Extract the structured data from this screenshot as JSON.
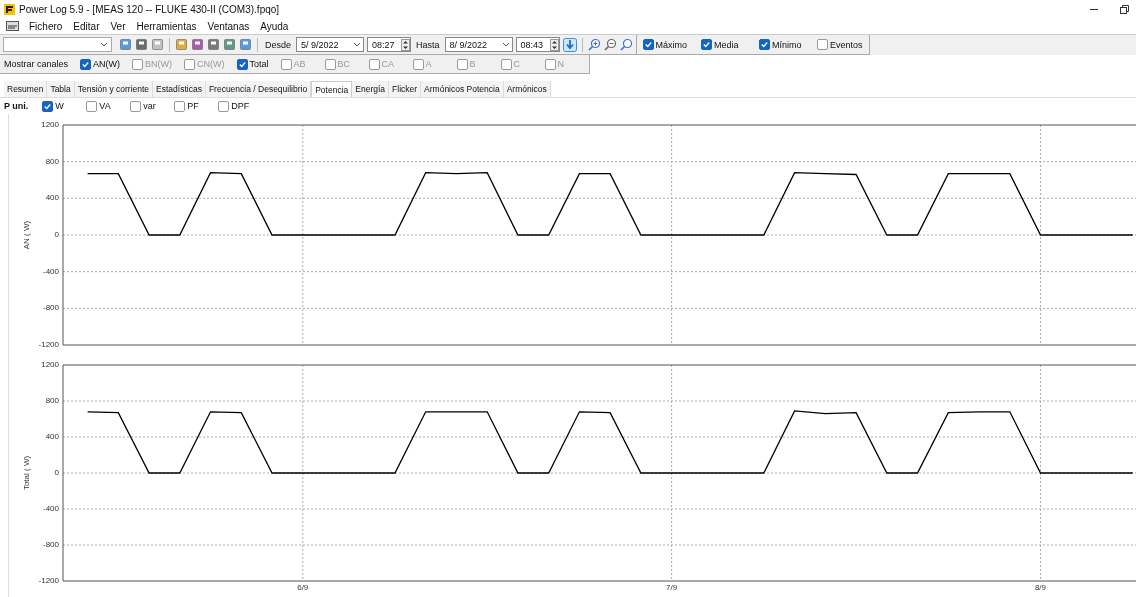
{
  "window": {
    "title": "Power Log 5.9 - [MEAS 120 -- FLUKE 430-II (COM3).fpqo]"
  },
  "menu": [
    "Fichero",
    "Editar",
    "Ver",
    "Herramientas",
    "Ventanas",
    "Ayuda"
  ],
  "range": {
    "from_label": "Desde",
    "from_date": "5/ 9/2022",
    "from_time": "08:27",
    "to_label": "Hasta",
    "to_date": "8/ 9/2022",
    "to_time": "08:43"
  },
  "display_options": [
    {
      "label": "Máximo",
      "checked": true
    },
    {
      "label": "Media",
      "checked": true
    },
    {
      "label": "Mínimo",
      "checked": true
    },
    {
      "label": "Eventos",
      "checked": false
    }
  ],
  "channels": {
    "label": "Mostrar canales",
    "items": [
      {
        "label": "AN(W)",
        "checked": true,
        "disabled": false
      },
      {
        "label": "BN(W)",
        "checked": false,
        "disabled": true
      },
      {
        "label": "CN(W)",
        "checked": false,
        "disabled": true
      },
      {
        "label": "Total",
        "checked": true,
        "disabled": false
      },
      {
        "label": "AB",
        "checked": false,
        "disabled": true
      },
      {
        "label": "BC",
        "checked": false,
        "disabled": true
      },
      {
        "label": "CA",
        "checked": false,
        "disabled": true
      },
      {
        "label": "A",
        "checked": false,
        "disabled": true
      },
      {
        "label": "B",
        "checked": false,
        "disabled": true
      },
      {
        "label": "C",
        "checked": false,
        "disabled": true
      },
      {
        "label": "N",
        "checked": false,
        "disabled": true
      }
    ]
  },
  "tabs": [
    {
      "label": "Resumen",
      "selected": false
    },
    {
      "label": "Tabla",
      "selected": false
    },
    {
      "label": "Tensión y corriente",
      "selected": false
    },
    {
      "label": "Estadísticas",
      "selected": false
    },
    {
      "label": "Frecuencia / Desequilibrio",
      "selected": false
    },
    {
      "label": "Potencia",
      "selected": true
    },
    {
      "label": "Energía",
      "selected": false
    },
    {
      "label": "Flicker",
      "selected": false
    },
    {
      "label": "Armónicos Potencia",
      "selected": false
    },
    {
      "label": "Armónicos",
      "selected": false
    }
  ],
  "units": {
    "label": "P uni.",
    "items": [
      {
        "label": "W",
        "checked": true
      },
      {
        "label": "VA",
        "checked": false
      },
      {
        "label": "var",
        "checked": false
      },
      {
        "label": "PF",
        "checked": false
      },
      {
        "label": "DPF",
        "checked": false
      }
    ]
  },
  "charts": [
    {
      "chart_data": {
        "type": "line",
        "grid": true,
        "ylabel": "AN ( W)",
        "ylim": [
          -1200,
          1200
        ],
        "yticks": [
          1200,
          800,
          400,
          0,
          -400,
          -800,
          -1200
        ],
        "categories": [
          null,
          null,
          null,
          null,
          null,
          null,
          null,
          null,
          null,
          null,
          null,
          null,
          null,
          null,
          null,
          null,
          null,
          null,
          null,
          null,
          null,
          null,
          null,
          null,
          null,
          null,
          null,
          null,
          null,
          null,
          null,
          null,
          null,
          null,
          null
        ],
        "series": [
          {
            "color": "#000000",
            "values": [
              670,
              670,
              0,
              0,
              680,
              670,
              0,
              0,
              0,
              0,
              0,
              680,
              670,
              680,
              0,
              0,
              670,
              670,
              0,
              0,
              0,
              0,
              0,
              680,
              670,
              660,
              0,
              0,
              670,
              670,
              670,
              0,
              0,
              0,
              0
            ]
          }
        ]
      }
    },
    {
      "chart_data": {
        "type": "line",
        "grid": true,
        "ylabel": "Total ( W)",
        "ylim": [
          -1200,
          1200
        ],
        "yticks": [
          1200,
          800,
          400,
          0,
          -400,
          -800,
          -1200
        ],
        "categories": [
          null,
          null,
          null,
          null,
          null,
          null,
          null,
          "6/9",
          null,
          null,
          null,
          null,
          null,
          null,
          null,
          null,
          null,
          null,
          null,
          "7/9",
          null,
          null,
          null,
          null,
          null,
          null,
          null,
          null,
          null,
          null,
          null,
          "8/9",
          null,
          null,
          null
        ],
        "series": [
          {
            "color": "#000000",
            "values": [
              680,
              670,
              0,
              0,
              680,
              670,
              0,
              0,
              0,
              0,
              0,
              680,
              680,
              680,
              0,
              0,
              680,
              670,
              0,
              0,
              0,
              0,
              0,
              690,
              660,
              670,
              0,
              0,
              670,
              680,
              680,
              0,
              0,
              0,
              0
            ]
          }
        ]
      }
    }
  ]
}
